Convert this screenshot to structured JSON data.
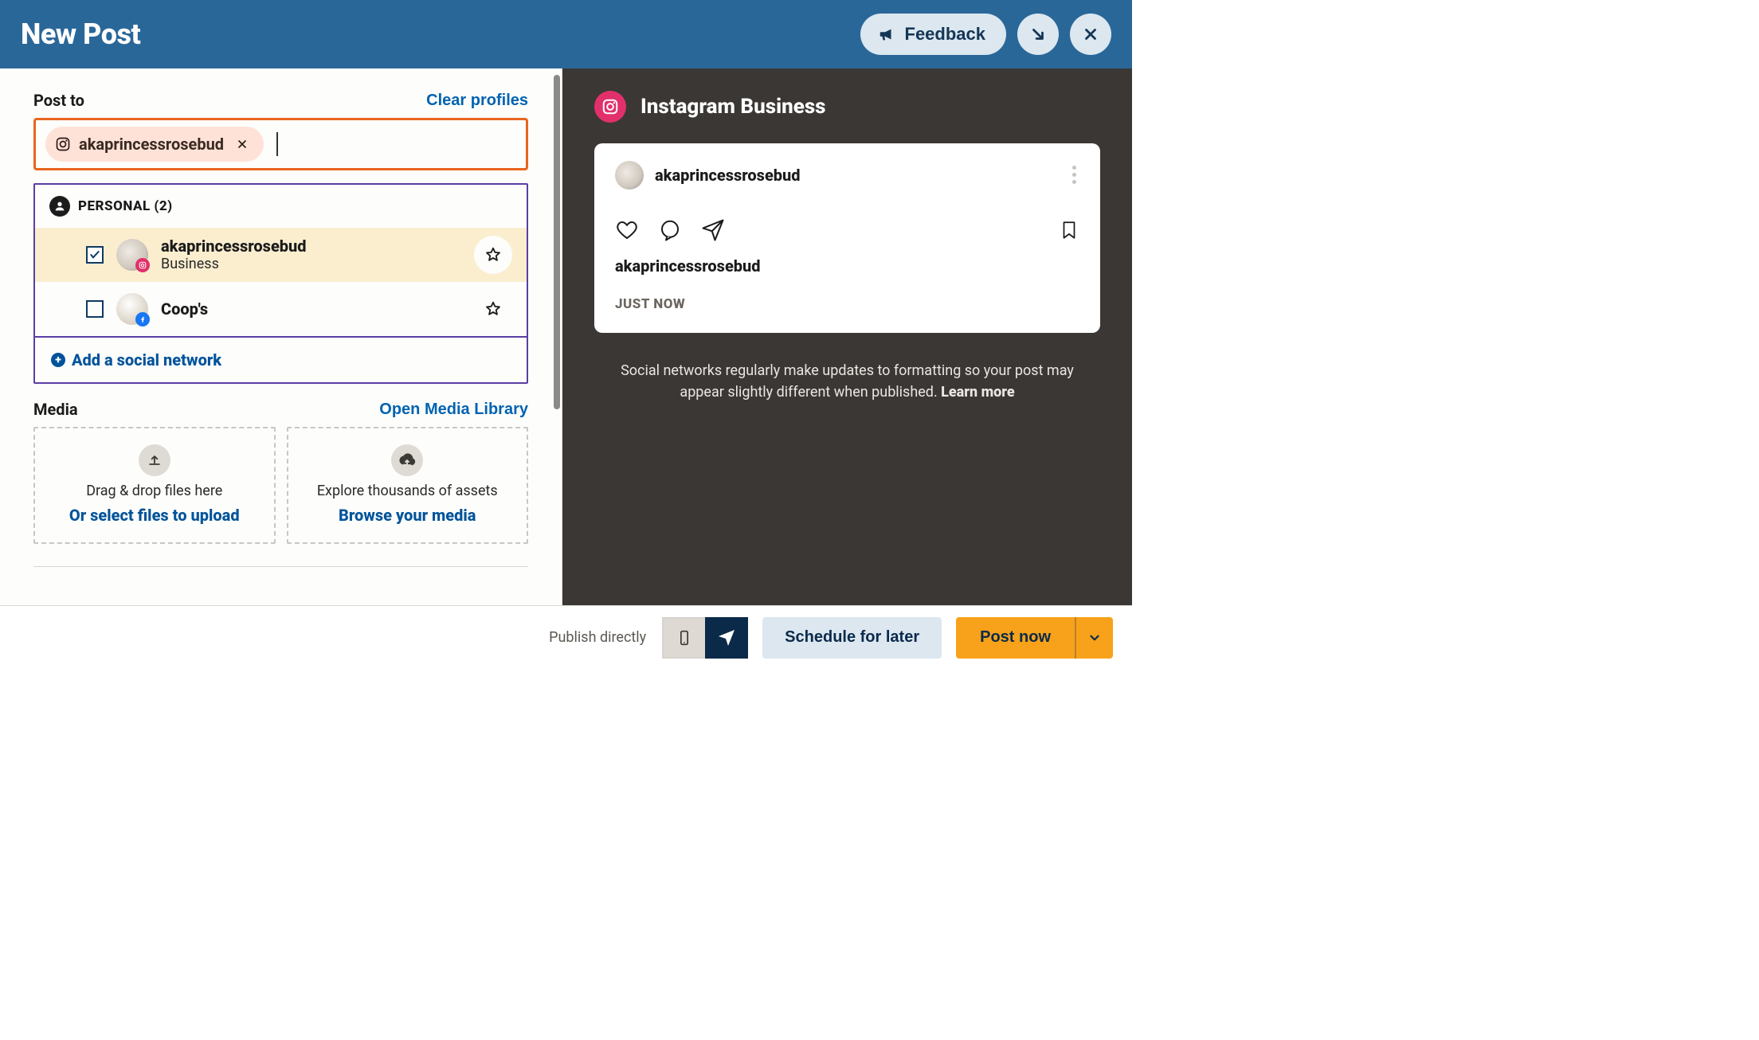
{
  "header": {
    "title": "New Post",
    "feedback_label": "Feedback"
  },
  "post_to": {
    "label": "Post to",
    "clear_label": "Clear profiles",
    "selected_chip": "akaprincessrosebud"
  },
  "profile_panel": {
    "group_label": "PERSONAL (2)",
    "add_label": "Add a social network",
    "profiles": [
      {
        "name": "akaprincessrosebud",
        "sub": "Business",
        "checked": true,
        "network": "ig"
      },
      {
        "name": "Coop's",
        "sub": "",
        "checked": false,
        "network": "fb"
      }
    ]
  },
  "media": {
    "label": "Media",
    "open_library": "Open Media Library",
    "box1_line1": "Drag & drop files here",
    "box1_link": "Or select files to upload",
    "box2_line1": "Explore thousands of assets",
    "box2_link": "Browse your media"
  },
  "preview": {
    "title": "Instagram Business",
    "card_name": "akaprincessrosebud",
    "caption_user": "akaprincessrosebud",
    "timestamp": "JUST NOW",
    "help_text_1": "Social networks regularly make updates to formatting so your post may appear slightly different when published. ",
    "help_link": "Learn more"
  },
  "footer": {
    "publish_label": "Publish directly",
    "schedule_label": "Schedule for later",
    "postnow_label": "Post now"
  }
}
